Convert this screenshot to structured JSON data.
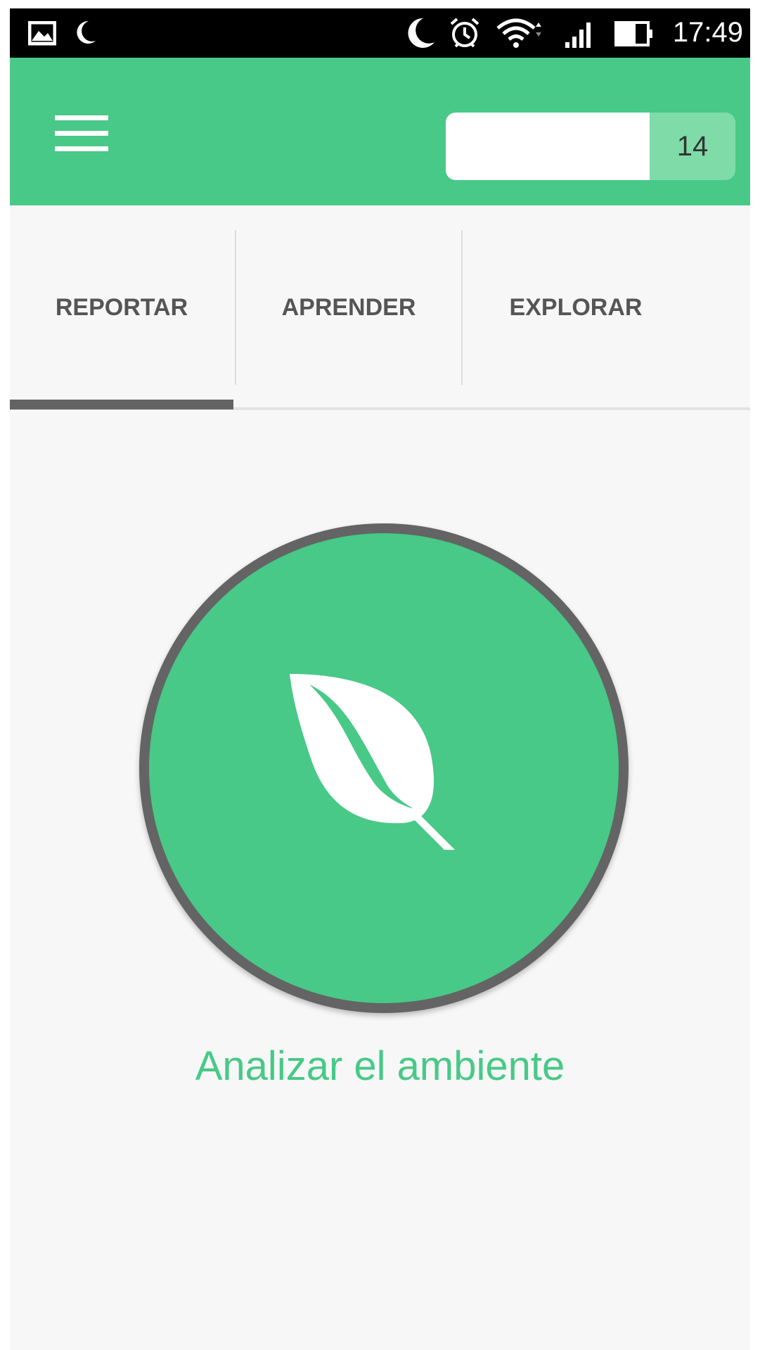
{
  "status_bar": {
    "time": "17:49",
    "icons": [
      "gallery-icon",
      "moon-icon",
      "night-mode-icon",
      "alarm-icon",
      "wifi-icon",
      "signal-icon",
      "battery-icon"
    ]
  },
  "app_bar": {
    "menu_icon": "hamburger-menu-icon",
    "search": {
      "value": "",
      "placeholder": "",
      "count": "14"
    }
  },
  "tabs": [
    {
      "label": "REPORTAR",
      "active": true
    },
    {
      "label": "APRENDER",
      "active": false
    },
    {
      "label": "EXPLORAR",
      "active": false
    }
  ],
  "main": {
    "analyze_icon": "leaf-icon",
    "analyze_label": "Analizar el ambiente"
  },
  "colors": {
    "brand_green": "#48c987",
    "count_green": "#7fdba8",
    "ring_gray": "#646464",
    "tab_text": "#555555"
  }
}
